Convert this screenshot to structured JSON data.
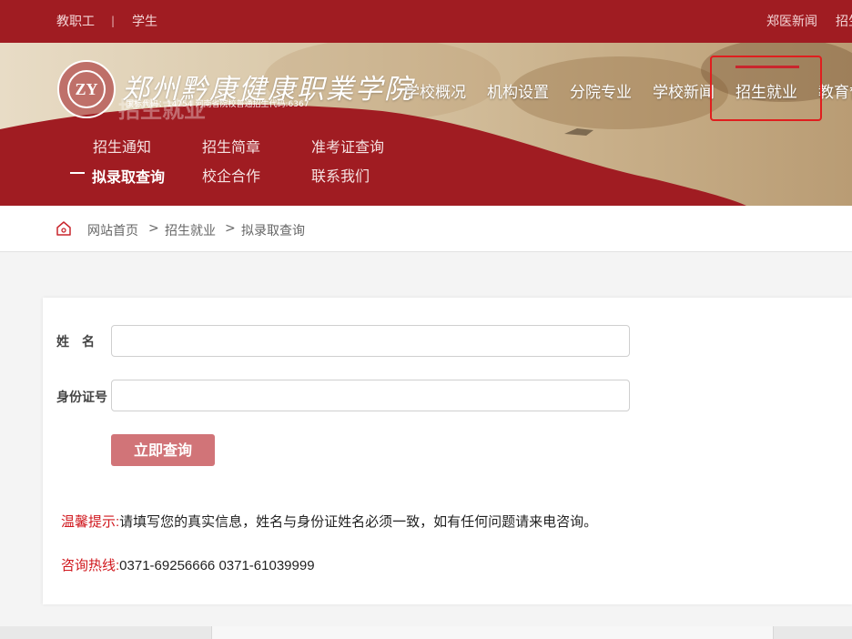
{
  "topbar": {
    "left_links": [
      "教职工",
      "学生"
    ],
    "separator": "|",
    "right_links": [
      "郑医新闻",
      "招生"
    ]
  },
  "header": {
    "logo_text": "ZY",
    "school_name": "郑州黔康健康职業学院",
    "school_code": "国标代码：14754 河南省院校普通招生代码:6367",
    "ghost_title": "招生就业"
  },
  "main_nav": {
    "items": [
      "学校概况",
      "机构设置",
      "分院专业",
      "学校新闻",
      "招生就业",
      "教育督"
    ],
    "active": "招生就业"
  },
  "sub_nav": {
    "items": [
      "招生通知",
      "招生简章",
      "准考证查询",
      "拟录取查询",
      "校企合作",
      "联系我们"
    ],
    "current": "拟录取查询"
  },
  "breadcrumb": {
    "items": [
      "网站首页",
      "招生就业",
      "拟录取查询"
    ],
    "separator": ">"
  },
  "form": {
    "name_label": "姓　名",
    "name_value": "",
    "id_label": "身份证号",
    "id_value": "",
    "submit_label": "立即查询"
  },
  "notes": {
    "tip_label": "温馨提示:",
    "tip_text": "请填写您的真实信息，姓名与身份证姓名必须一致，如有任何问题请来电咨询。",
    "hotline_label": "咨询热线:",
    "hotline_text": "0371-69256666 0371-61039999"
  },
  "colors": {
    "brand_red": "#a01c22",
    "button": "#d17478",
    "highlight": "#d0181e"
  }
}
